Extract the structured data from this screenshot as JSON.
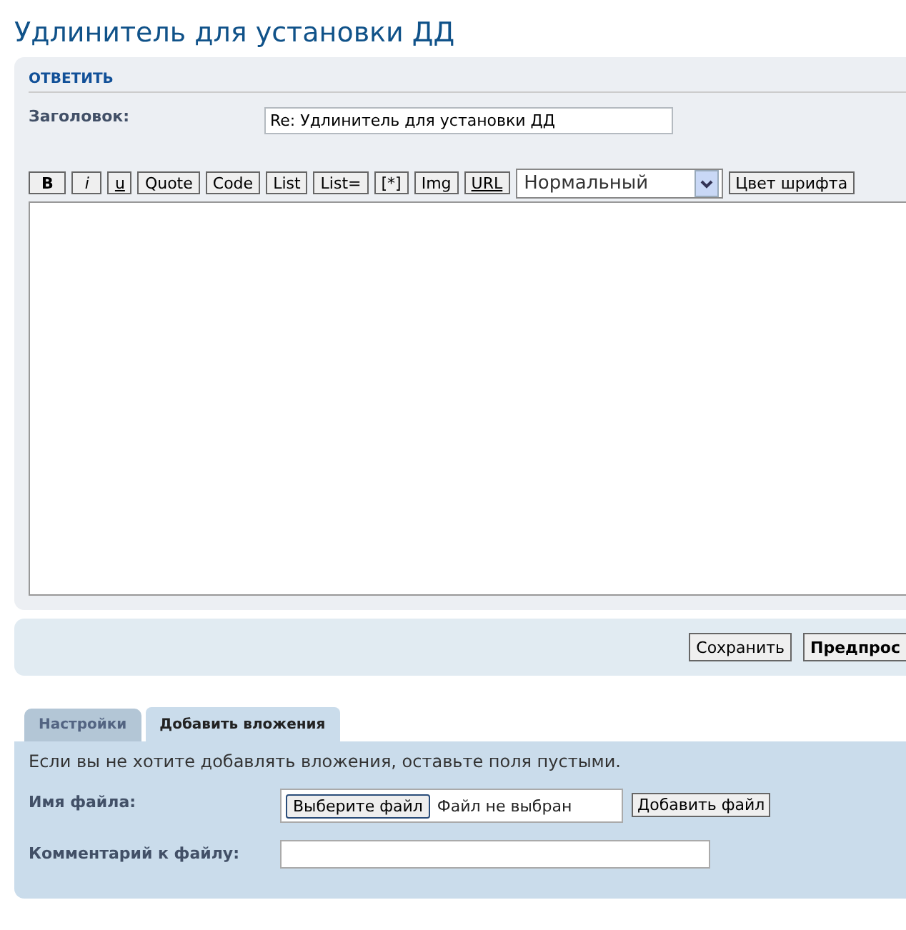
{
  "page_title": "Удлинитель для установки ДД",
  "reply_panel": {
    "heading": "ОТВЕТИТЬ",
    "subject_label": "Заголовок:",
    "subject_value": "Re: Удлинитель для установки ДД",
    "toolbar": [
      {
        "label": "B",
        "kind": "bold"
      },
      {
        "label": "i",
        "kind": "italic"
      },
      {
        "label": "u",
        "kind": "underline"
      },
      {
        "label": "Quote",
        "kind": "plain"
      },
      {
        "label": "Code",
        "kind": "plain"
      },
      {
        "label": "List",
        "kind": "plain"
      },
      {
        "label": "List=",
        "kind": "plain"
      },
      {
        "label": "[*]",
        "kind": "plain"
      },
      {
        "label": "Img",
        "kind": "plain"
      },
      {
        "label": "URL",
        "kind": "underline"
      }
    ],
    "font_size_select": "Нормальный",
    "font_color_button": "Цвет шрифта"
  },
  "action_buttons": [
    {
      "label": "Сохранить",
      "kind": "plain"
    },
    {
      "label": "Предпрос",
      "kind": "bold"
    }
  ],
  "tabs": [
    {
      "label": "Настройки",
      "selected": false
    },
    {
      "label": "Добавить вложения",
      "selected": true
    }
  ],
  "attachments": {
    "hint": "Если вы не хотите добавлять вложения, оставьте поля пустыми.",
    "file_label": "Имя файла:",
    "choose_button": "Выберите файл",
    "no_file_text": "Файл не выбран",
    "add_button": "Добавить файл",
    "comment_label": "Комментарий к файлу:"
  }
}
